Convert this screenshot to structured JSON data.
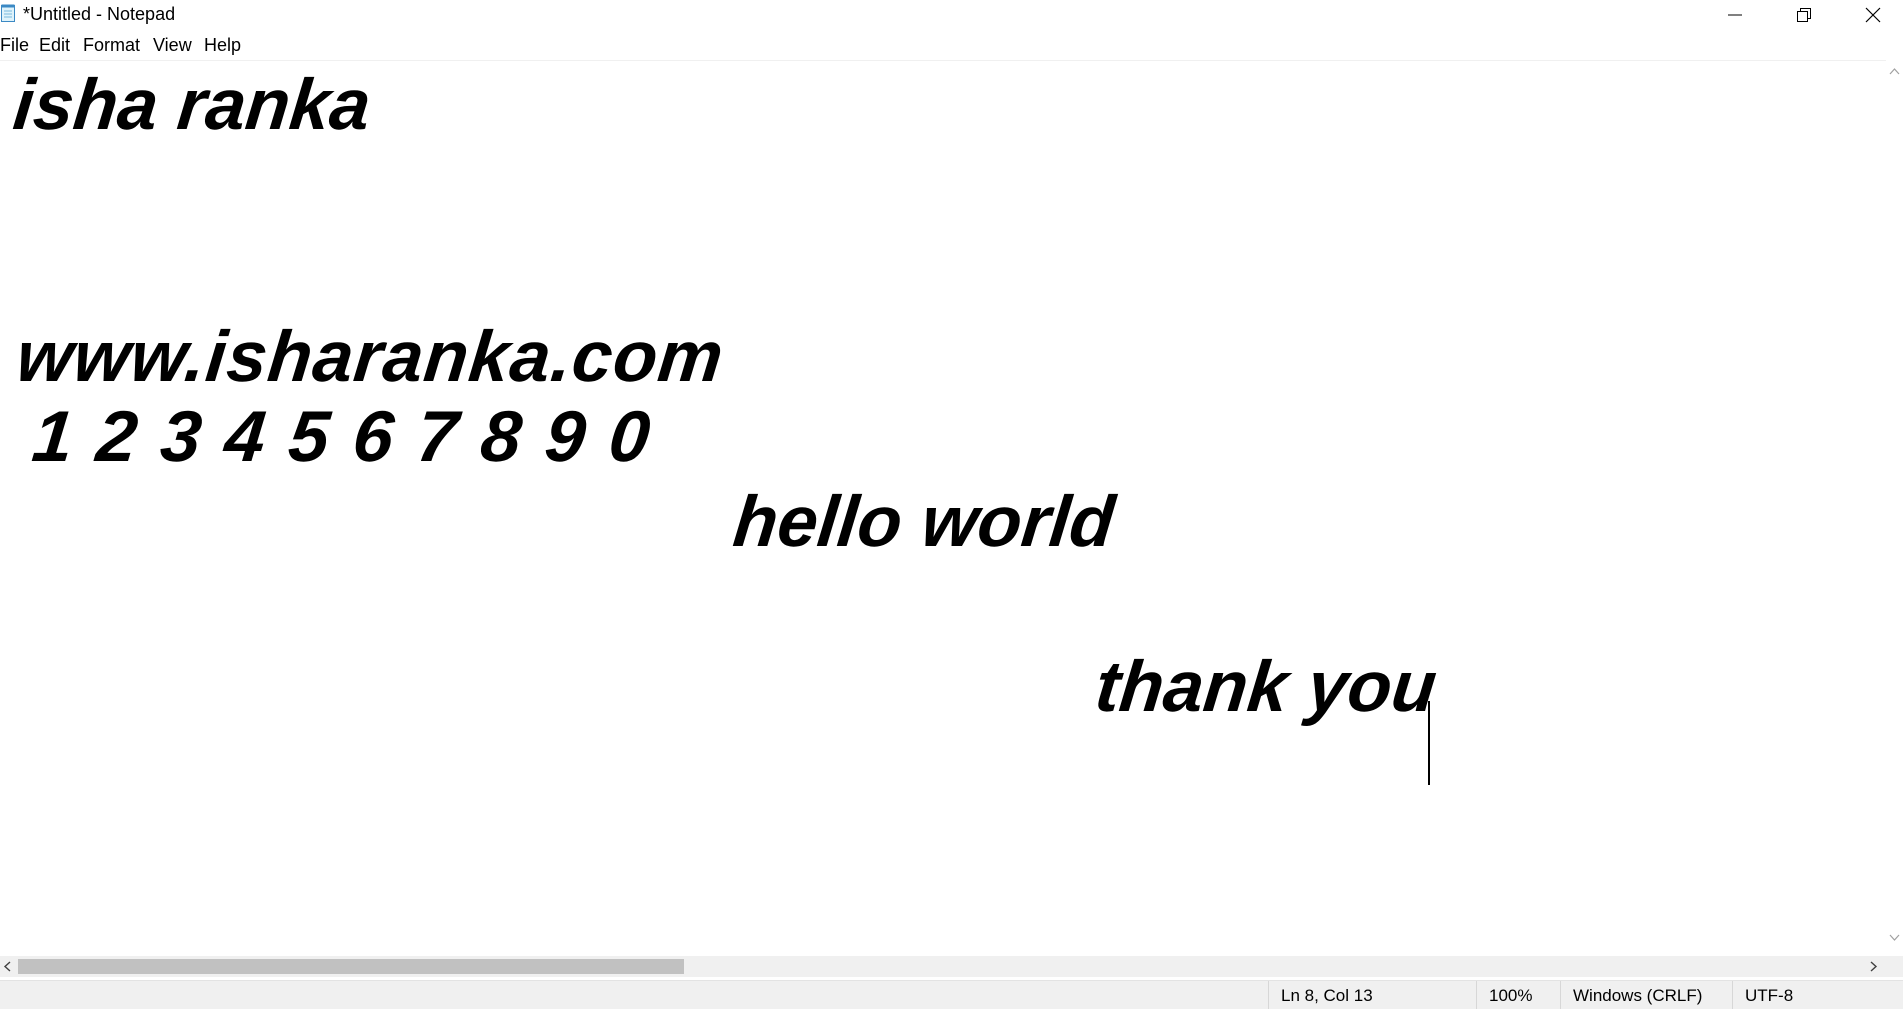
{
  "window": {
    "title": "*Untitled - Notepad",
    "minimize_icon": "minimize-icon",
    "maximize_icon": "restore-icon",
    "close_icon": "close-icon"
  },
  "menu": {
    "items": [
      "File",
      "Edit",
      "Format",
      "View",
      "Help"
    ]
  },
  "editor": {
    "lines": [
      "isha ranka",
      "www.isharanka.com",
      "1 2 3 4 5 6 7 8 9 0",
      "hello world",
      "thank you"
    ]
  },
  "statusbar": {
    "position": "Ln 8, Col 13",
    "zoom": "100%",
    "line_ending": "Windows (CRLF)",
    "encoding": "UTF-8"
  },
  "scrollbar": {
    "horizontal_thumb_fraction": 0.36
  }
}
